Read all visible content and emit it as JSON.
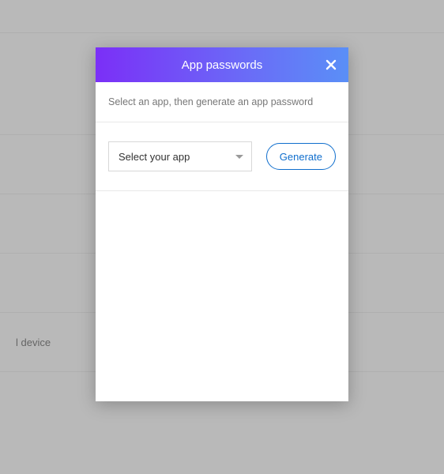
{
  "background": {
    "device_text": "l device"
  },
  "modal": {
    "title": "App passwords",
    "instruction": "Select an app, then generate an app password",
    "select_label": "Select your app",
    "generate_label": "Generate"
  }
}
